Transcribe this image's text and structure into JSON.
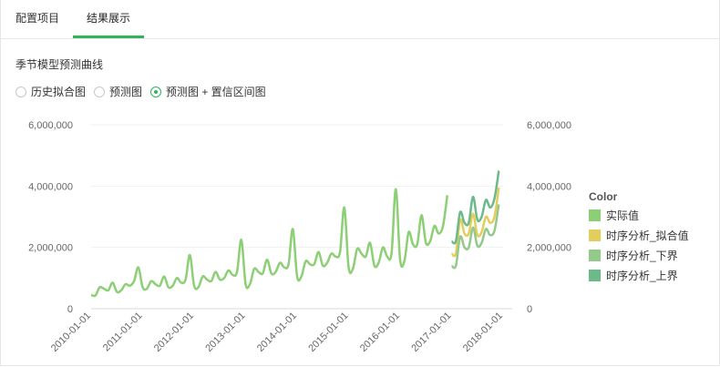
{
  "tabs": [
    {
      "label": "配置项目",
      "active": false
    },
    {
      "label": "结果展示",
      "active": true
    }
  ],
  "accent_color": "#2fb45a",
  "section_title": "季节模型预测曲线",
  "view_options": [
    {
      "label": "历史拟合图",
      "checked": false
    },
    {
      "label": "预测图",
      "checked": false
    },
    {
      "label": "预测图 + 置信区间图",
      "checked": true
    }
  ],
  "chart_data": {
    "type": "line",
    "ylim": [
      0,
      6000000
    ],
    "y_ticks": [
      "0",
      "2,000,000",
      "4,000,000",
      "6,000,000"
    ],
    "y_tick_values": [
      0,
      2000000,
      4000000,
      6000000
    ],
    "x_ticks": [
      "2010-01-01",
      "2011-01-01",
      "2012-01-01",
      "2013-01-01",
      "2014-01-01",
      "2015-01-01",
      "2016-01-01",
      "2017-01-01",
      "2018-01-01"
    ],
    "xlim": [
      "2010-01-01",
      "2018-01-01"
    ],
    "grid": true,
    "legend": {
      "title": "Color",
      "placement": "right"
    },
    "series": [
      {
        "name": "实际值",
        "color": "#8ccf74",
        "x": [
          "2010-01",
          "2010-02",
          "2010-03",
          "2010-04",
          "2010-05",
          "2010-06",
          "2010-07",
          "2010-08",
          "2010-09",
          "2010-10",
          "2010-11",
          "2010-12",
          "2011-01",
          "2011-02",
          "2011-03",
          "2011-04",
          "2011-05",
          "2011-06",
          "2011-07",
          "2011-08",
          "2011-09",
          "2011-10",
          "2011-11",
          "2011-12",
          "2012-01",
          "2012-02",
          "2012-03",
          "2012-04",
          "2012-05",
          "2012-06",
          "2012-07",
          "2012-08",
          "2012-09",
          "2012-10",
          "2012-11",
          "2012-12",
          "2013-01",
          "2013-02",
          "2013-03",
          "2013-04",
          "2013-05",
          "2013-06",
          "2013-07",
          "2013-08",
          "2013-09",
          "2013-10",
          "2013-11",
          "2013-12",
          "2014-01",
          "2014-02",
          "2014-03",
          "2014-04",
          "2014-05",
          "2014-06",
          "2014-07",
          "2014-08",
          "2014-09",
          "2014-10",
          "2014-11",
          "2014-12",
          "2015-01",
          "2015-02",
          "2015-03",
          "2015-04",
          "2015-05",
          "2015-06",
          "2015-07",
          "2015-08",
          "2015-09",
          "2015-10",
          "2015-11",
          "2015-12",
          "2016-01",
          "2016-02",
          "2016-03",
          "2016-04",
          "2016-05",
          "2016-06",
          "2016-07",
          "2016-08",
          "2016-09",
          "2016-10",
          "2016-11",
          "2016-12"
        ],
        "values": [
          450000,
          430000,
          700000,
          650000,
          600000,
          850000,
          550000,
          600000,
          800000,
          750000,
          900000,
          1350000,
          700000,
          650000,
          900000,
          800000,
          750000,
          1050000,
          700000,
          750000,
          1000000,
          850000,
          950000,
          1750000,
          750000,
          700000,
          1050000,
          950000,
          900000,
          1200000,
          950000,
          1000000,
          1250000,
          1100000,
          1200000,
          2250000,
          800000,
          800000,
          1300000,
          1200000,
          1150000,
          1600000,
          1150000,
          1200000,
          1500000,
          1350000,
          1450000,
          2600000,
          1050000,
          1050000,
          1550000,
          1450000,
          1450000,
          1850000,
          1400000,
          1500000,
          1800000,
          1700000,
          1850000,
          3300000,
          1350000,
          1300000,
          1950000,
          1800000,
          1700000,
          2150000,
          1400000,
          1500000,
          2000000,
          1700000,
          1800000,
          3900000,
          1600000,
          1550000,
          2500000,
          2100000,
          2100000,
          3050000,
          2150000,
          2200000,
          2700000,
          2450000,
          2700000,
          3700000
        ]
      },
      {
        "name": "时序分析_拟合值",
        "color": "#e3cd5b",
        "x": [
          "2017-01",
          "2017-02",
          "2017-03",
          "2017-04",
          "2017-05",
          "2017-06",
          "2017-07",
          "2017-08",
          "2017-09",
          "2017-10",
          "2017-11",
          "2017-12"
        ],
        "values": [
          1800000,
          1800000,
          2900000,
          2450000,
          2450000,
          3100000,
          2400000,
          2500000,
          3000000,
          2800000,
          3000000,
          3950000
        ]
      },
      {
        "name": "时序分析_下界",
        "color": "#93c98a",
        "x": [
          "2017-01",
          "2017-02",
          "2017-03",
          "2017-04",
          "2017-05",
          "2017-06",
          "2017-07",
          "2017-08",
          "2017-09",
          "2017-10",
          "2017-11",
          "2017-12"
        ],
        "values": [
          1400000,
          1400000,
          2350000,
          2000000,
          2000000,
          2650000,
          2050000,
          2150000,
          2600000,
          2400000,
          2550000,
          3400000
        ]
      },
      {
        "name": "时序分析_上界",
        "color": "#6cb98a",
        "x": [
          "2017-01",
          "2017-02",
          "2017-03",
          "2017-04",
          "2017-05",
          "2017-06",
          "2017-07",
          "2017-08",
          "2017-09",
          "2017-10",
          "2017-11",
          "2017-12"
        ],
        "values": [
          2200000,
          2200000,
          3150000,
          2800000,
          2800000,
          3650000,
          2900000,
          3000000,
          3550000,
          3300000,
          3600000,
          4500000
        ]
      }
    ]
  }
}
